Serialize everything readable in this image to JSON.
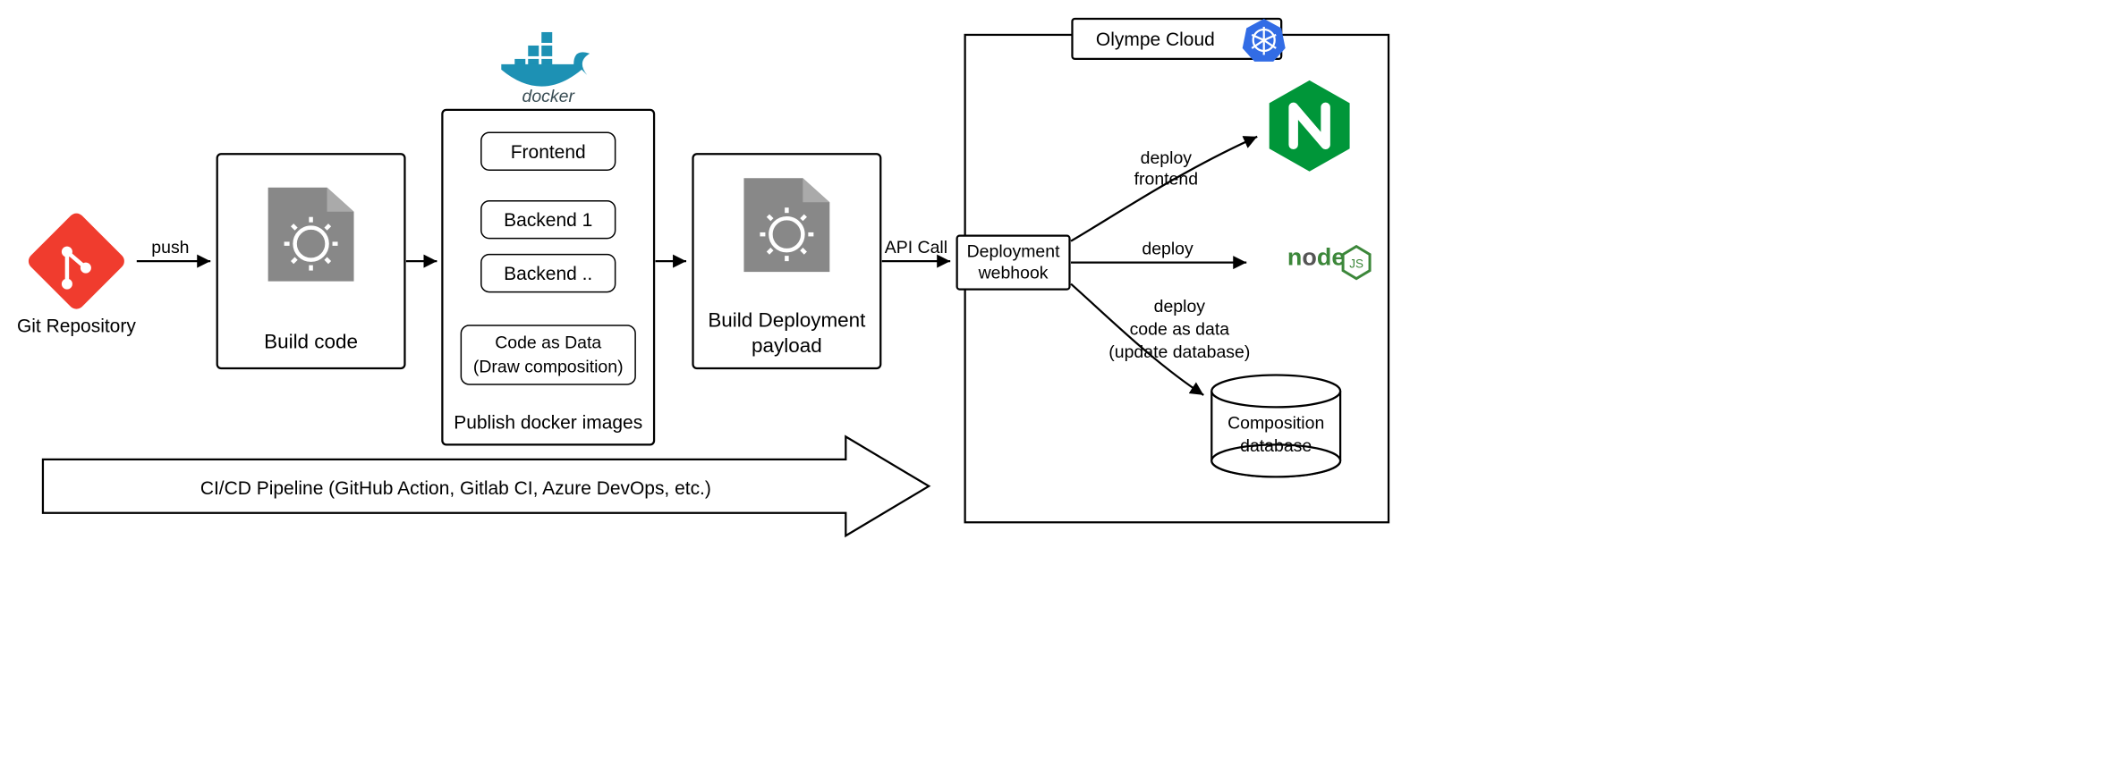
{
  "git_repo": {
    "label": "Git Repository"
  },
  "build_code": {
    "label": "Build code"
  },
  "docker_panel": {
    "title": "Publish docker images",
    "docker_label": "docker",
    "items": {
      "frontend": "Frontend",
      "backend1": "Backend 1",
      "backend2": "Backend ..",
      "code_as_data_l1": "Code as Data",
      "code_as_data_l2": "(Draw composition)"
    }
  },
  "build_deploy": {
    "l1": "Build Deployment",
    "l2": "payload"
  },
  "arrows": {
    "push": "push",
    "api_call": "API Call",
    "deploy_frontend_l1": "deploy",
    "deploy_frontend_l2": "frontend",
    "deploy": "deploy",
    "deploy_db_l1": "deploy",
    "deploy_db_l2": "code as data",
    "deploy_db_l3": "(update database)"
  },
  "cloud": {
    "title": "Olympe Cloud",
    "webhook_l1": "Deployment",
    "webhook_l2": "webhook",
    "db_l1": "Composition",
    "db_l2": "database"
  },
  "pipeline_label": "CI/CD Pipeline (GitHub Action, Gitlab CI, Azure DevOps, etc.)"
}
